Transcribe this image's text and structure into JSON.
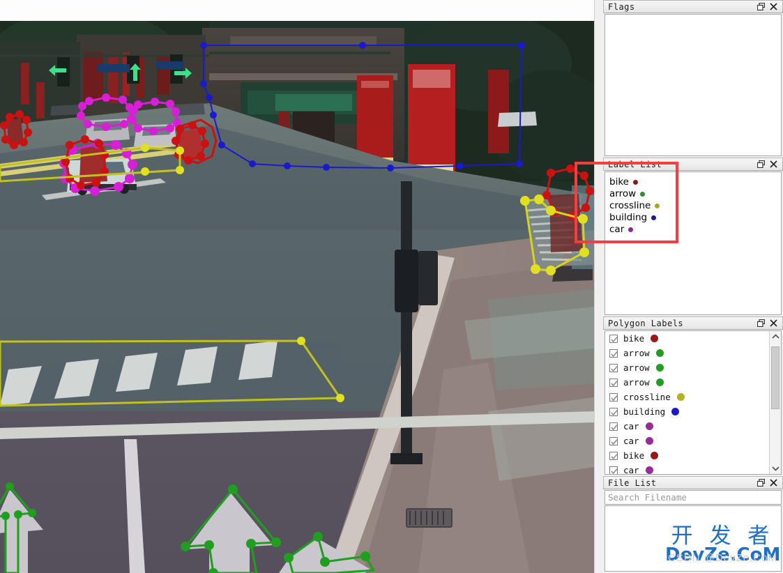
{
  "panels": {
    "flags": {
      "title": "Flags",
      "float_icon": "float-icon",
      "close_icon": "close-icon",
      "items": []
    },
    "label_list": {
      "title": "Label List",
      "float_icon": "float-icon",
      "close_icon": "close-icon",
      "items": [
        {
          "label": "bike",
          "color": "#8b1a1a"
        },
        {
          "label": "arrow",
          "color": "#2e8b2e"
        },
        {
          "label": "crossline",
          "color": "#a8a81e"
        },
        {
          "label": "building",
          "color": "#1a1a8b"
        },
        {
          "label": "car",
          "color": "#8b2a8b"
        }
      ]
    },
    "polygon_labels": {
      "title": "Polygon Labels",
      "float_icon": "float-icon",
      "close_icon": "close-icon",
      "scroll_up_icon": "chevron-up-icon",
      "scroll_down_icon": "chevron-down-icon",
      "items": [
        {
          "label": "bike",
          "color": "#9b1616",
          "checked": true
        },
        {
          "label": "arrow",
          "color": "#1f9e1f",
          "checked": true
        },
        {
          "label": "arrow",
          "color": "#1f9e1f",
          "checked": true
        },
        {
          "label": "arrow",
          "color": "#1f9e1f",
          "checked": true
        },
        {
          "label": "crossline",
          "color": "#b2b21c",
          "checked": true
        },
        {
          "label": "building",
          "color": "#1a1acd",
          "checked": true
        },
        {
          "label": "car",
          "color": "#9a2a9a",
          "checked": true
        },
        {
          "label": "car",
          "color": "#9a2a9a",
          "checked": true
        },
        {
          "label": "bike",
          "color": "#9b1616",
          "checked": true
        },
        {
          "label": "car",
          "color": "#9a2a9a",
          "checked": true
        }
      ]
    },
    "file_list": {
      "title": "File List",
      "float_icon": "float-icon",
      "close_icon": "close-icon",
      "search_placeholder": "Search Filename",
      "search_value": "",
      "items": []
    }
  },
  "watermark": {
    "cn_text": "开 发 者",
    "en_text": "DevZe.CoM",
    "ghost_text": "CSDN @DevZe.CoM",
    "color": "#1f6fc4"
  },
  "annotation_colors": {
    "bike": "#cc1111",
    "arrow": "#1f9e1f",
    "crossline": "#b2b21c",
    "building": "#1a1acd",
    "car": "#d61fd6",
    "highlight_rect": "#f04040"
  },
  "scene": {
    "description": "Traffic intersection camera image with labelme polygon annotations"
  }
}
